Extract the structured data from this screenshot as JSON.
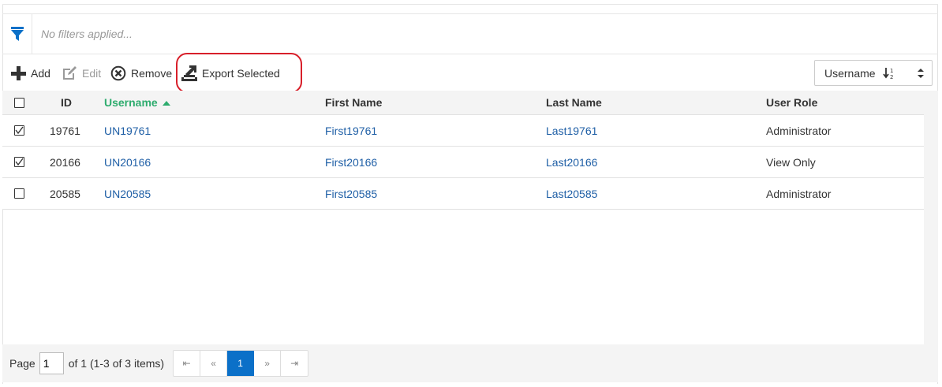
{
  "filter": {
    "text": "No filters applied..."
  },
  "toolbar": {
    "add_label": "Add",
    "edit_label": "Edit",
    "remove_label": "Remove",
    "export_label": "Export Selected"
  },
  "sort": {
    "selected": "Username"
  },
  "columns": {
    "id": "ID",
    "username": "Username",
    "first_name": "First Name",
    "last_name": "Last Name",
    "user_role": "User Role"
  },
  "rows": [
    {
      "checked": true,
      "id": "19761",
      "username": "UN19761",
      "first_name": "First19761",
      "last_name": "Last19761",
      "user_role": "Administrator"
    },
    {
      "checked": true,
      "id": "20166",
      "username": "UN20166",
      "first_name": "First20166",
      "last_name": "Last20166",
      "user_role": "View Only"
    },
    {
      "checked": false,
      "id": "20585",
      "username": "UN20585",
      "first_name": "First20585",
      "last_name": "Last20585",
      "user_role": "Administrator"
    }
  ],
  "pager": {
    "page_label": "Page",
    "page_value": "1",
    "of_text": "of 1 (1-3 of 3 items)",
    "first": "⇤",
    "prev": "«",
    "current": "1",
    "next": "»",
    "last": "⇥"
  },
  "colors": {
    "accent": "#0b70c8",
    "sorted_header": "#2eac6e",
    "link": "#1f5fa6",
    "highlight": "#d81f2a"
  },
  "icons": {
    "filter": "filter-icon",
    "add": "plus-icon",
    "edit": "edit-icon",
    "remove": "remove-circle-icon",
    "export": "export-icon",
    "sort": "sort-numeric-icon"
  }
}
